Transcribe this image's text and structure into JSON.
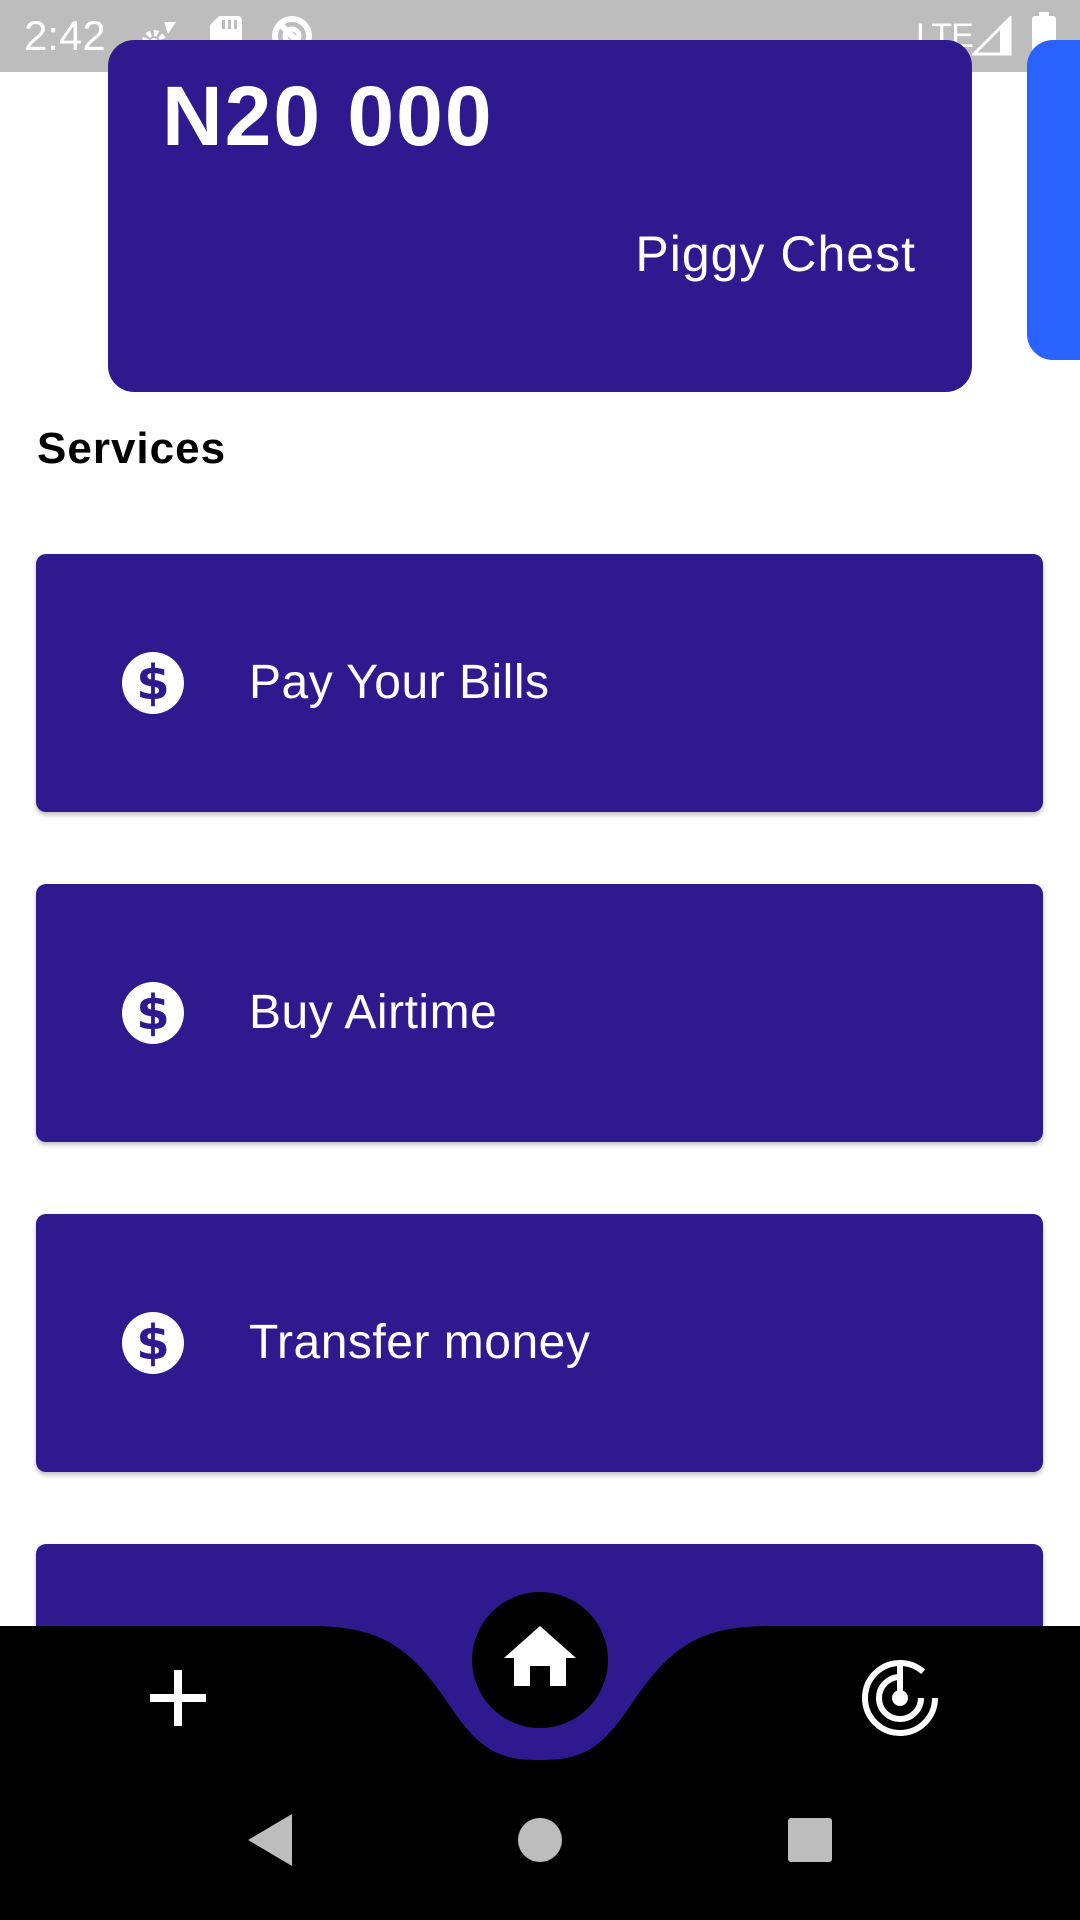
{
  "status_bar": {
    "time": "2:42",
    "network": "LTE",
    "icons": [
      "settings-icon",
      "sd-card-icon",
      "sync-disabled-icon",
      "signal-icon",
      "battery-icon"
    ]
  },
  "balance_cards": [
    {
      "amount": "N20 000",
      "name": "Piggy Chest",
      "color": "#2e1a8e"
    },
    {
      "color": "#2962ff"
    }
  ],
  "services": {
    "title": "Services",
    "items": [
      {
        "label": "Pay Your Bills",
        "icon": "dollar-icon"
      },
      {
        "label": "Buy Airtime",
        "icon": "dollar-icon"
      },
      {
        "label": "Transfer money",
        "icon": "dollar-icon"
      },
      {
        "label": "",
        "icon": ""
      }
    ],
    "card_color": "#2e1a8e"
  },
  "bottom_nav": {
    "items": [
      "add-icon",
      "home-icon",
      "radar-icon"
    ],
    "active": "home-icon"
  },
  "system_nav": [
    "back-icon",
    "home-circle-icon",
    "recents-icon"
  ]
}
